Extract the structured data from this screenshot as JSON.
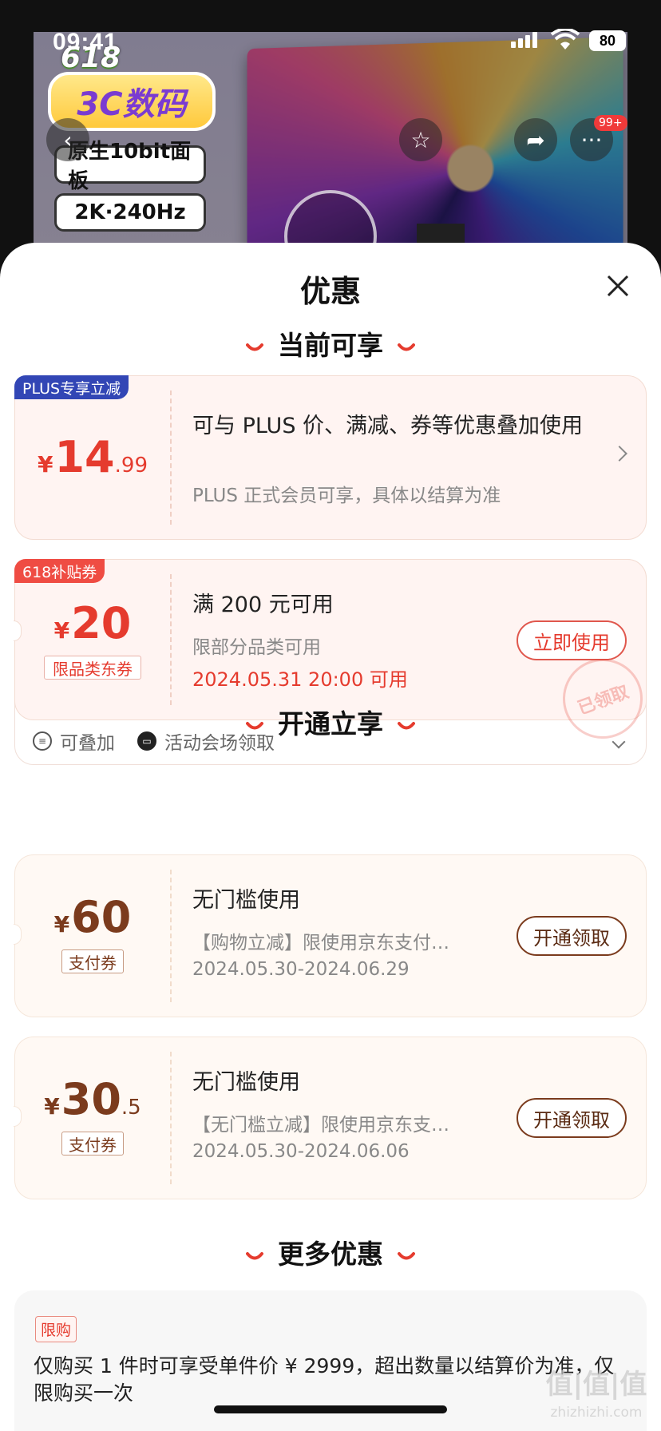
{
  "status": {
    "time": "09:41",
    "battery": "80"
  },
  "background": {
    "promo_618": "618",
    "promo_3c": "3C数码",
    "tags": [
      "原生10bit面板",
      "2K·240Hz"
    ],
    "cart_badge": "99+"
  },
  "sheet": {
    "title": "优惠"
  },
  "sections": {
    "current": "当前可享",
    "open": "开通立享",
    "more": "更多优惠"
  },
  "plus_card": {
    "tag": "PLUS专享立减",
    "yen": "¥",
    "price_int": "14",
    "price_dec": ".99",
    "title": "可与 PLUS 价、满减、券等优惠叠加使用",
    "subtitle": "PLUS 正式会员可享，具体以结算为准"
  },
  "subsidy_card": {
    "tag": "618补贴券",
    "yen": "¥",
    "price": "20",
    "type_label": "限品类东券",
    "title": "满 200 元可用",
    "subtitle": "限部分品类可用",
    "valid": "2024.05.31 20:00 可用",
    "button": "立即使用",
    "stamp": "已领取",
    "meta_stackable": "可叠加",
    "meta_source": "活动会场领取"
  },
  "pay_cards": [
    {
      "yen": "¥",
      "price_int": "60",
      "price_dec": "",
      "type_label": "支付券",
      "title": "无门槛使用",
      "subtitle": "【购物立减】限使用京东支付…",
      "valid": "2024.05.30-2024.06.29",
      "button": "开通领取"
    },
    {
      "yen": "¥",
      "price_int": "30",
      "price_dec": ".5",
      "type_label": "支付券",
      "title": "无门槛使用",
      "subtitle": "【无门槛立减】限使用京东支…",
      "valid": "2024.05.30-2024.06.06",
      "button": "开通领取"
    }
  ],
  "more": {
    "tag": "限购",
    "text": "仅购买 1 件时可享受单件价 ¥ 2999，超出数量以结算价为准，仅限购买一次"
  },
  "watermark": {
    "main": "值|值|值",
    "sub": "zhizhizhi.com"
  }
}
